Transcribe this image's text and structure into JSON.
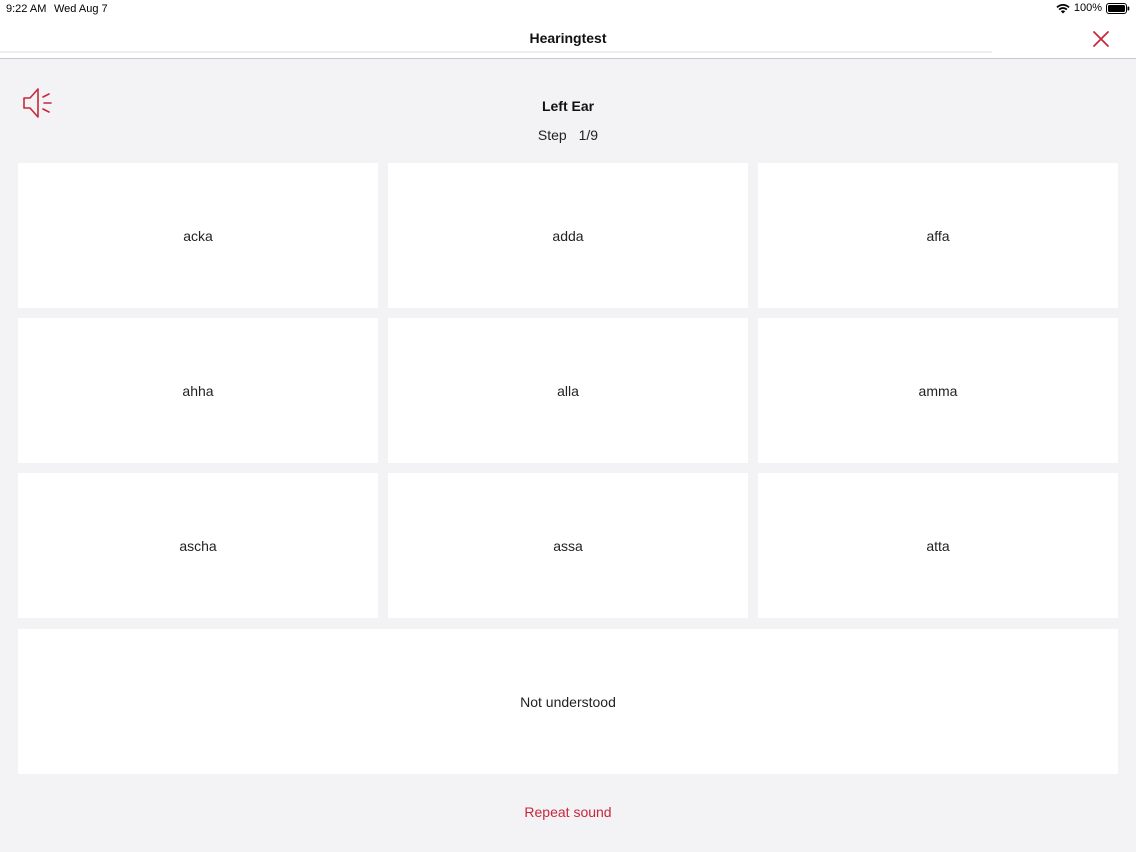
{
  "status": {
    "time": "9:22 AM",
    "date": "Wed Aug 7",
    "battery": "100%"
  },
  "nav": {
    "title": "Hearingtest"
  },
  "test": {
    "ear": "Left Ear",
    "step_label": "Step",
    "step_value": "1/9"
  },
  "options": [
    {
      "label": "acka"
    },
    {
      "label": "adda"
    },
    {
      "label": "affa"
    },
    {
      "label": "ahha"
    },
    {
      "label": "alla"
    },
    {
      "label": "amma"
    },
    {
      "label": "ascha"
    },
    {
      "label": "assa"
    },
    {
      "label": "atta"
    }
  ],
  "not_understood_label": "Not understood",
  "repeat_label": "Repeat sound",
  "colors": {
    "accent": "#c8283c",
    "background": "#f3f2f4",
    "card": "#ffffff"
  },
  "icons": {
    "close": "close-icon",
    "speaker": "speaker-icon",
    "wifi": "wifi-icon",
    "battery": "battery-icon"
  }
}
